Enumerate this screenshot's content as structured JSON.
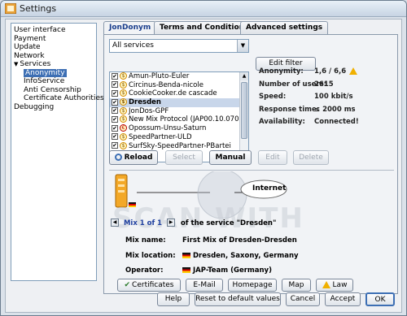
{
  "window": {
    "title": "Settings"
  },
  "tree": {
    "items": [
      {
        "label": "User interface",
        "level": 0
      },
      {
        "label": "Payment",
        "level": 0
      },
      {
        "label": "Update",
        "level": 0
      },
      {
        "label": "Network",
        "level": 0
      },
      {
        "label": "Services",
        "level": 0,
        "expanded": true
      },
      {
        "label": "Anonymity",
        "level": 1,
        "selected": true
      },
      {
        "label": "InfoService",
        "level": 1
      },
      {
        "label": "Anti Censorship",
        "level": 1
      },
      {
        "label": "Certificate Authorities",
        "level": 1
      },
      {
        "label": "Debugging",
        "level": 0
      }
    ]
  },
  "tabs": [
    {
      "label": "JonDonym",
      "active": true
    },
    {
      "label": "Terms and Conditions",
      "active": false
    },
    {
      "label": "Advanced settings",
      "active": false
    }
  ],
  "service_filter": {
    "value": "All services",
    "edit_filter_label": "Edit filter"
  },
  "services": [
    {
      "name": "Amun-Pluto-Euler",
      "checked": true
    },
    {
      "name": "Circinus-Benda-nicole",
      "checked": true
    },
    {
      "name": "CookieCooker.de cascade",
      "checked": true
    },
    {
      "name": "Dresden",
      "checked": true,
      "selected": true
    },
    {
      "name": "JonDos-GPF",
      "checked": true
    },
    {
      "name": "New Mix Protocol (JAP00.10.070)",
      "checked": true
    },
    {
      "name": "Opossum-Unsu-Saturn",
      "checked": true
    },
    {
      "name": "SpeedPartner-ULD",
      "checked": true
    },
    {
      "name": "SurfSky-SpeedPartner-PBartei",
      "checked": true
    }
  ],
  "stats": {
    "anonymity": {
      "label": "Anonymity:",
      "value": "1,6 / 6,6"
    },
    "users": {
      "label": "Number of users:",
      "value": "2615"
    },
    "speed": {
      "label": "Speed:",
      "value": "100 kbit/s"
    },
    "response": {
      "label": "Response time:",
      "value": "≤ 2000 ms"
    },
    "availability": {
      "label": "Availability:",
      "value": "Connected!"
    }
  },
  "list_buttons": {
    "reload": "Reload",
    "select": "Select",
    "manual": "Manual",
    "edit": "Edit",
    "delete": "Delete"
  },
  "diagram": {
    "internet_label": "Internet",
    "watermark": "SCAN WITH"
  },
  "mix_nav": {
    "mix_label": "Mix 1 of 1",
    "service_text": "of the service \"Dresden\""
  },
  "mix_info": {
    "name": {
      "label": "Mix name:",
      "value": "First Mix of Dresden-Dresden"
    },
    "location": {
      "label": "Mix location:",
      "value": "Dresden, Saxony, Germany"
    },
    "operator": {
      "label": "Operator:",
      "value": "JAP-Team  (Germany)"
    }
  },
  "mix_buttons": {
    "certificates": "Certificates",
    "email": "E-Mail",
    "homepage": "Homepage",
    "map": "Map",
    "law": "Law"
  },
  "dialog_buttons": {
    "help": "Help",
    "reset": "Reset to default values",
    "cancel": "Cancel",
    "accept": "Accept",
    "ok": "OK"
  },
  "colors": {
    "accent": "#1a3e8c",
    "selection": "#3d6fb4",
    "warning": "#f0b000",
    "link": "#2040a0"
  }
}
